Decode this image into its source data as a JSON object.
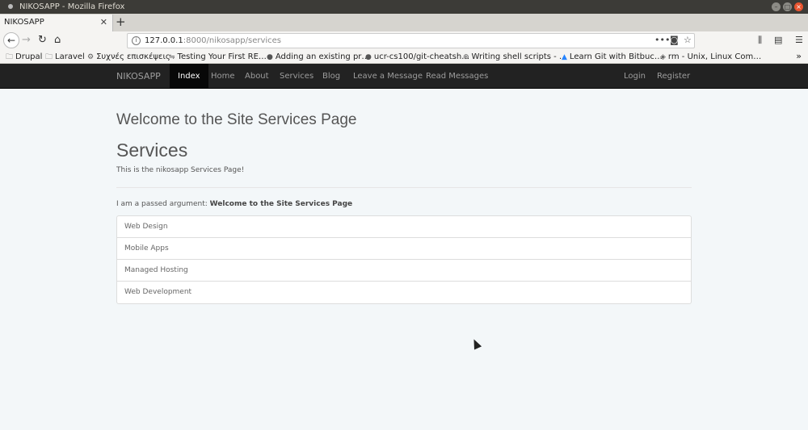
{
  "window": {
    "title": "NIKOSAPP - Mozilla Firefox"
  },
  "tab": {
    "title": "NIKOSAPP"
  },
  "urlbar": {
    "host": "127.0.0.1",
    "path": ":8000/nikosapp/services"
  },
  "bookmarks": [
    {
      "label": "Drupal",
      "icon": "folder-icon"
    },
    {
      "label": "Laravel",
      "icon": "folder-icon"
    },
    {
      "label": "Συχνές επισκέψεις",
      "icon": "gear-icon"
    },
    {
      "label": "Testing Your First RE…",
      "icon": "link-icon"
    },
    {
      "label": "Adding an existing pr…",
      "icon": "github-icon"
    },
    {
      "label": "ucr-cs100/git-cheatsh…",
      "icon": "github-icon"
    },
    {
      "label": "Writing shell scripts - …",
      "icon": "globe-icon"
    },
    {
      "label": "Learn Git with Bitbuc…",
      "icon": "bitbucket-icon"
    },
    {
      "label": "rm - Unix, Linux Com…",
      "icon": "diamond-icon"
    }
  ],
  "site": {
    "brand": "NIKOSAPP",
    "nav": [
      "Index",
      "Home",
      "About",
      "Services",
      "Blog",
      "Leave a Message",
      "Read Messages"
    ],
    "auth": [
      "Login",
      "Register"
    ]
  },
  "page": {
    "welcome": "Welcome to the Site Services Page",
    "heading": "Services",
    "intro": "This is the nikosapp Services Page!",
    "passed_label": "I am a passed argument:",
    "passed_value": "Welcome to the Site Services Page",
    "services": [
      "Web Design",
      "Mobile Apps",
      "Managed Hosting",
      "Web Development"
    ]
  }
}
